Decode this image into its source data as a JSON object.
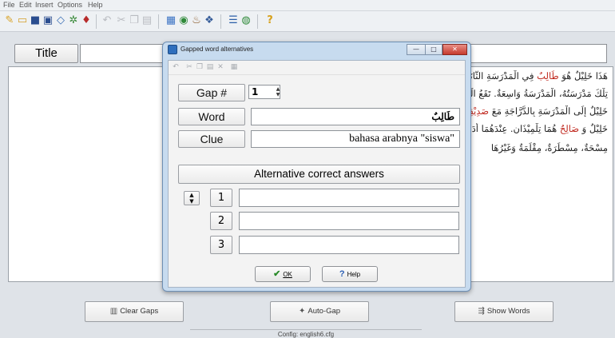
{
  "menubar": {
    "items": [
      "File",
      "Edit",
      "Insert",
      "Options",
      "Help"
    ]
  },
  "main": {
    "title_button_label": "Title",
    "title_value": "",
    "text_lines": [
      "هَذَا خَلِيْلٌ هُوَ طَالِبٌ فِي الْمَدْرَسَةِ الثَّانَوِيَّةِ. ذَهَبَ إِلَى الْمَدْرَسَةِ كُلَّ يَوْمٍ مُبَكِّرًا. أُنْظُرْ!",
      "تِلْكَ مَدْرَسَتُهُ، الْمَدْرَسَةُ وَاسِعَةٌ. تَقَعُ الْمَدْرَسَةُ فِي الْمَدِيْنَةِ. وَبَيْتُهُ قَرِيْبٌ مِنَ الْمَدْرَسَةِ. يَذْهَبُ",
      "خَلِيْلٌ إِلَى الْمَدْرَسَةِ بِالدَّرَّاجَةِ مَعَ صَدِيْقِهِ فِي الْفَصْلِ",
      "خَلِيْلٌ وَ صَالِحٌ هُمَا تِلْمِيْذَانِ. عِنْدَهُمَا أَدَوَاتٌ مَدْرَسِيَّةٌ مِثْلُ: كِتَابُ الدَّرْسِ، كُرَّاسَةٌ، قَلَمٌ، خَرِيْطَةٌ،",
      "مِسْحَةٌ، مِسْطَرَةٌ، مِقْلَمَةٌ وَغَيْرُهَا"
    ],
    "gap_words": [
      "طَالِبٌ",
      "صَدِيْقِهِ",
      "صَالِحٌ"
    ]
  },
  "bottom": {
    "clear_gaps_label": "Clear Gaps",
    "auto_gap_label": "Auto-Gap",
    "show_words_label": "Show Words",
    "status_text": "Config: english6.cfg"
  },
  "dialog": {
    "title": "Gapped word alternatives",
    "gap_label": "Gap #",
    "gap_value": "1",
    "word_label": "Word",
    "word_value": "طَالِبٌ",
    "clue_label": "Clue",
    "clue_value": "\"bahasa arabnya \"siswa",
    "alt_header": "Alternative correct answers",
    "alt_rows": [
      {
        "num": "1",
        "value": ""
      },
      {
        "num": "2",
        "value": ""
      },
      {
        "num": "3",
        "value": ""
      }
    ],
    "ok_label": "OK",
    "help_label": "Help"
  },
  "colors": {
    "gap_word": "#c0281e",
    "dialog_frame": "#c7dbef",
    "close_button": "#c53a2e"
  }
}
